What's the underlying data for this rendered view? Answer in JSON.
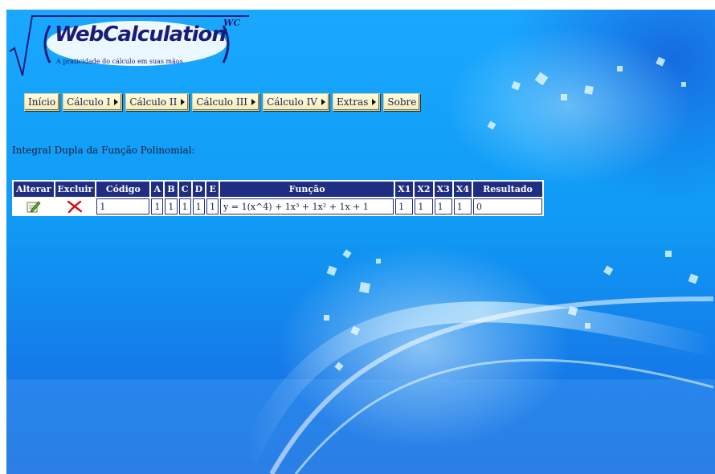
{
  "logo": {
    "wordmark": "WebCalculation",
    "tagline": "A praticidade do cálculo em suas mãos",
    "badge": "WC"
  },
  "menu": [
    {
      "label": "Início",
      "has_submenu": false
    },
    {
      "label": "Cálculo I",
      "has_submenu": true
    },
    {
      "label": "Cálculo II",
      "has_submenu": true
    },
    {
      "label": "Cálculo III",
      "has_submenu": true
    },
    {
      "label": "Cálculo IV",
      "has_submenu": true
    },
    {
      "label": "Extras",
      "has_submenu": true
    },
    {
      "label": "Sobre",
      "has_submenu": false
    }
  ],
  "page_title": "Integral Dupla da Função Polinomial:",
  "table": {
    "headers": [
      "Alterar",
      "Excluir",
      "Código",
      "A",
      "B",
      "C",
      "D",
      "E",
      "Função",
      "X1",
      "X2",
      "X3",
      "X4",
      "Resultado"
    ],
    "rows": [
      {
        "alterar_icon": "edit-icon",
        "excluir_icon": "delete-icon",
        "codigo": "1",
        "a": "1",
        "b": "1",
        "c": "1",
        "d": "1",
        "e": "1",
        "funcao": "y = 1(x^4) + 1x³ + 1x² + 1x + 1",
        "x1": "1",
        "x2": "1",
        "x3": "1",
        "x4": "1",
        "resultado": "0"
      }
    ]
  },
  "colors": {
    "header_bg": "#1f2e82",
    "background": "#0f9bf5",
    "button_bg": "#fffce0",
    "delete_red": "#d0101a"
  }
}
